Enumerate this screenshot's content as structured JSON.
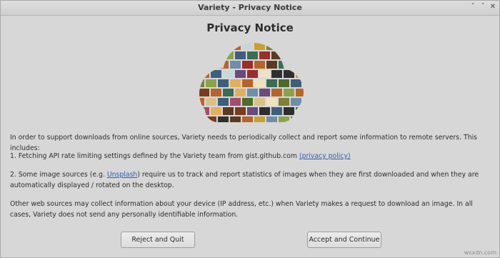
{
  "window": {
    "title": "Variety - Privacy Notice",
    "minimize_glyph": "ˇ",
    "maximize_glyph": "ˆ",
    "close_glyph": "✕"
  },
  "heading": "Privacy Notice",
  "image": {
    "description_icon": "cloud-collage-icon"
  },
  "notice": {
    "intro": "In order to support downloads from online sources, Variety needs to periodically collect and report some information to remote servers. This includes:",
    "item1_text": "1. Fetching API rate limiting settings defined by the Variety team from gist.github.com ",
    "item1_link": "(privacy policy)",
    "item2_prefix": "2. Some image sources (e.g. ",
    "item2_link": "Unsplash",
    "item2_suffix": ") require us to track and report statistics of images when they are first downloaded and when they are automatically displayed / rotated on the desktop.",
    "other": "Other web sources may collect information about your device (IP address, etc.) when Variety makes a request to download an image. In all cases, Variety does not send any personally identifiable information."
  },
  "buttons": {
    "reject": "Reject and Quit",
    "accept": "Accept and Continue"
  },
  "watermark": "wsxdn.com",
  "colors": {
    "link": "#2f5eb5",
    "background": "#d7d7d7"
  }
}
